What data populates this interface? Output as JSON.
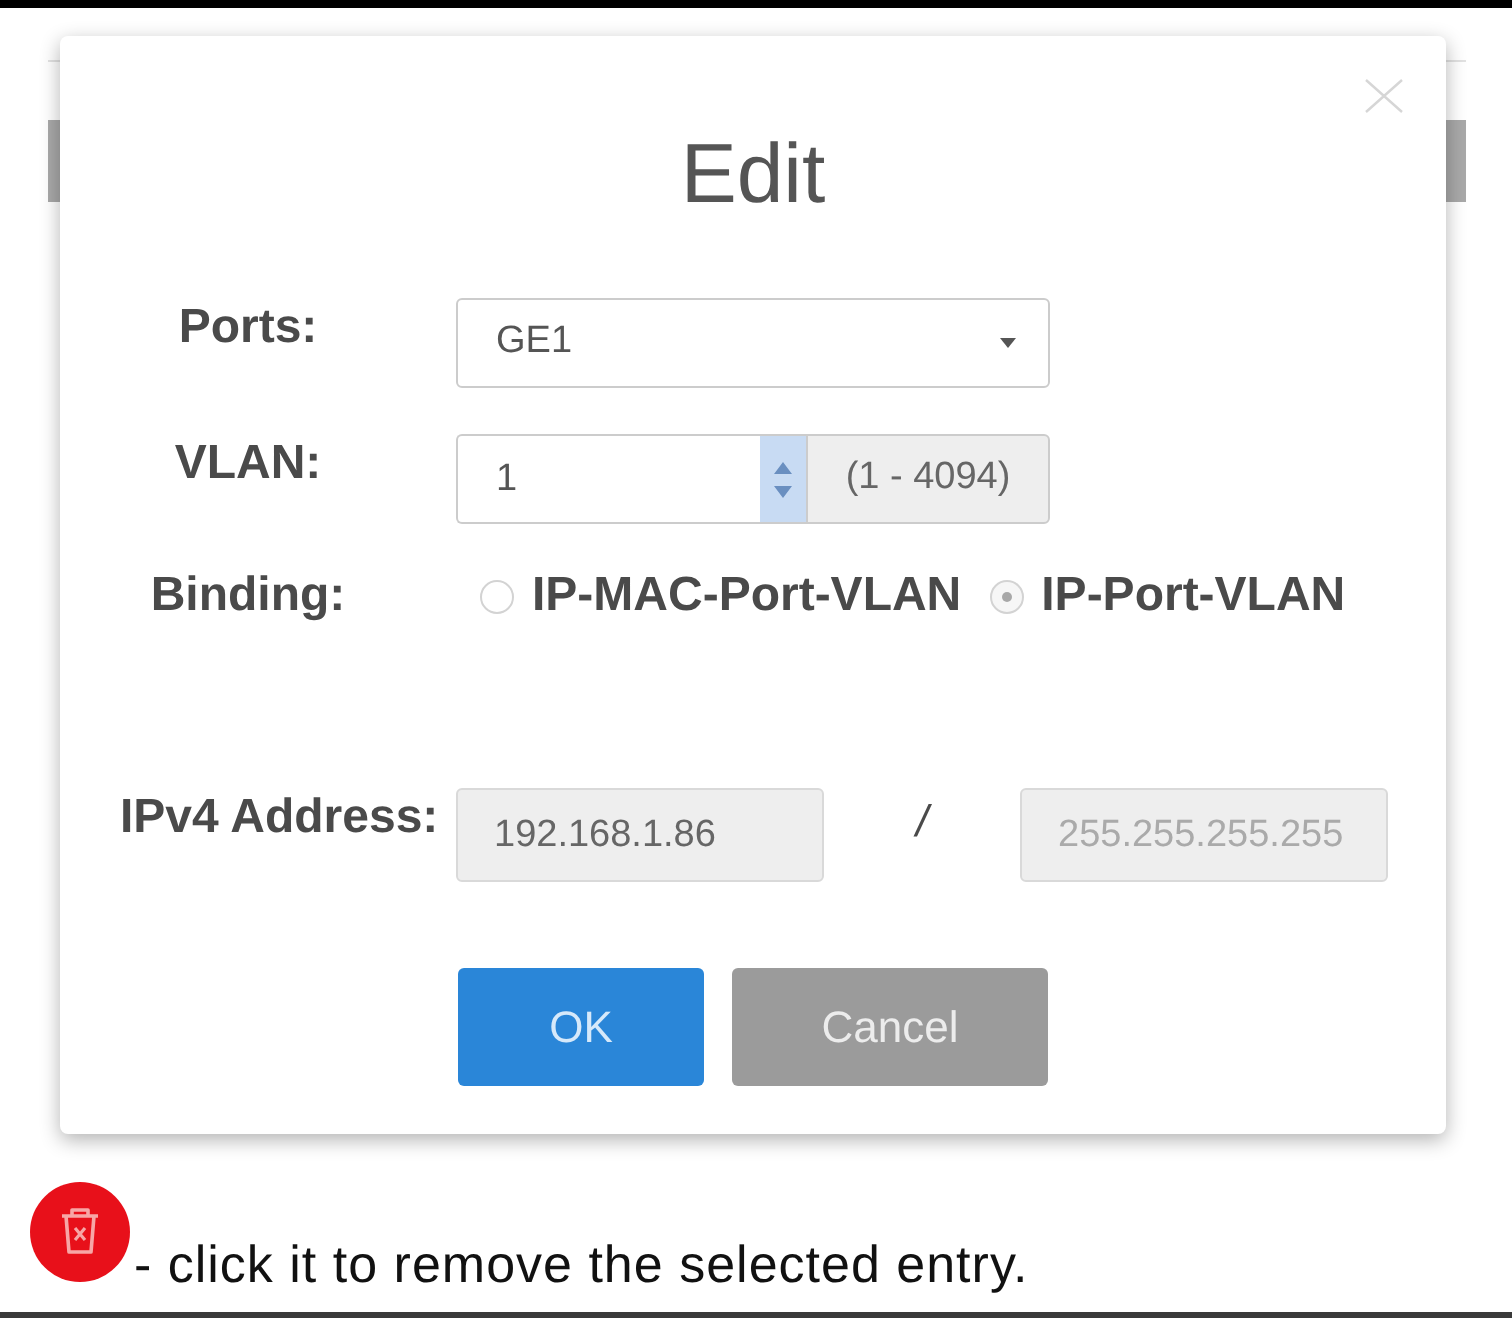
{
  "dialog": {
    "title": "Edit",
    "fields": [
      {
        "kind": "select",
        "label": "Ports:",
        "value": "GE1"
      },
      {
        "kind": "number",
        "label": "VLAN:",
        "value": "1",
        "range": "(1 - 4094)"
      },
      {
        "kind": "radio",
        "label": "Binding:",
        "options": [
          {
            "label": "IP-MAC-Port-VLAN",
            "selected": false
          },
          {
            "label": "IP-Port-VLAN",
            "selected": true
          }
        ]
      },
      {
        "kind": "address",
        "label": "IPv4 Address:",
        "address": {
          "value": "192.168.1.86",
          "disabled": true
        },
        "separator": "/",
        "mask": {
          "placeholder": "255.255.255.255",
          "disabled": true
        }
      }
    ],
    "buttons": [
      {
        "label": "OK",
        "kind": "primary"
      },
      {
        "label": "Cancel",
        "kind": "secondary"
      }
    ]
  },
  "help": {
    "text": "- click it to remove the selected entry."
  }
}
